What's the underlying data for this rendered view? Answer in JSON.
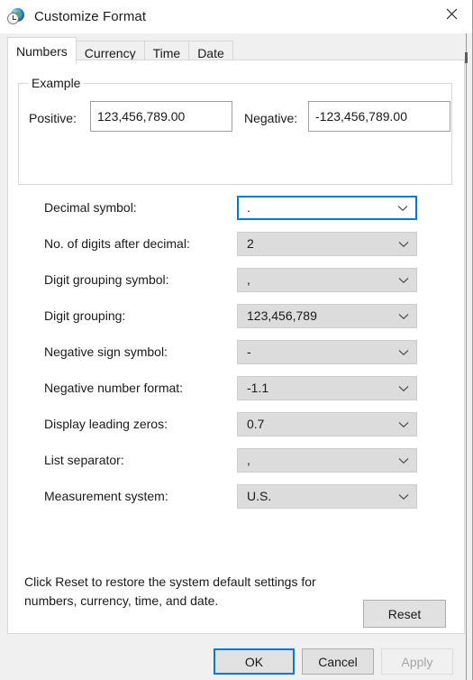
{
  "window": {
    "title": "Customize Format",
    "icon": "region-clock-globe-icon",
    "close_label": "close-icon"
  },
  "tabs": [
    {
      "label": "Numbers",
      "active": true
    },
    {
      "label": "Currency",
      "active": false
    },
    {
      "label": "Time",
      "active": false
    },
    {
      "label": "Date",
      "active": false
    }
  ],
  "example": {
    "group_title": "Example",
    "positive_label": "Positive:",
    "positive_value": "123,456,789.00",
    "negative_label": "Negative:",
    "negative_value": "-123,456,789.00"
  },
  "settings": [
    {
      "label": "Decimal symbol:",
      "value": ".",
      "focused": true
    },
    {
      "label": "No. of digits after decimal:",
      "value": "2",
      "focused": false
    },
    {
      "label": "Digit grouping symbol:",
      "value": ",",
      "focused": false
    },
    {
      "label": "Digit grouping:",
      "value": "123,456,789",
      "focused": false
    },
    {
      "label": "Negative sign symbol:",
      "value": "-",
      "focused": false
    },
    {
      "label": "Negative number format:",
      "value": "-1.1",
      "focused": false
    },
    {
      "label": "Display leading zeros:",
      "value": "0.7",
      "focused": false
    },
    {
      "label": "List separator:",
      "value": ",",
      "focused": false
    },
    {
      "label": "Measurement system:",
      "value": "U.S.",
      "focused": false
    }
  ],
  "reset": {
    "description": "Click Reset to restore the system default settings for numbers, currency, time, and date.",
    "button_label": "Reset"
  },
  "footer": {
    "ok_label": "OK",
    "cancel_label": "Cancel",
    "apply_label": "Apply",
    "apply_disabled": true
  },
  "colors": {
    "accent": "#0078d7",
    "dialog_background": "#f0f0f0",
    "panel_background": "#ffffff",
    "combo_background": "#dcdcdc",
    "disabled_text": "#a6a6a6"
  }
}
